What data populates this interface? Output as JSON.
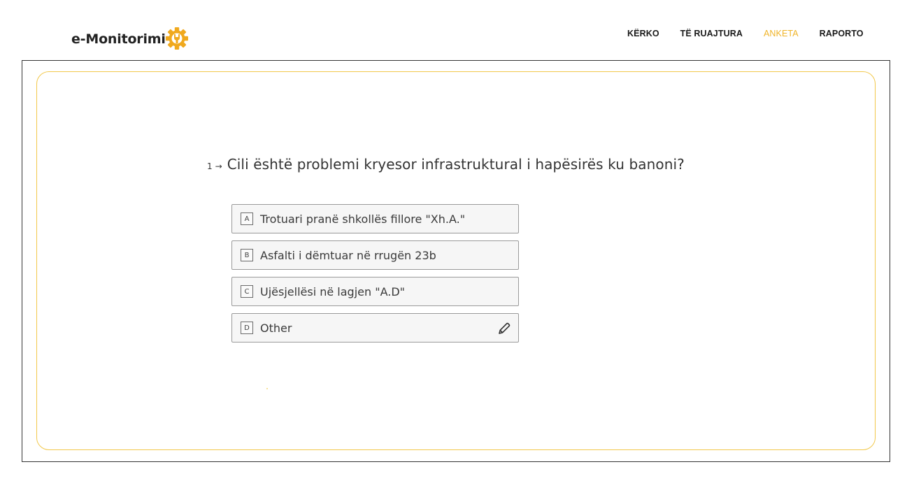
{
  "header": {
    "logo_text": "e-Monitorimi",
    "logo_icon": "gear-wrench-icon",
    "brand_color": "#f0b429"
  },
  "nav": {
    "items": [
      {
        "label": "KËRKO",
        "active": false
      },
      {
        "label": "TË RUAJTURA",
        "active": false
      },
      {
        "label": "ANKETA",
        "active": true
      },
      {
        "label": "RAPORTO",
        "active": false
      }
    ]
  },
  "question": {
    "number": "1",
    "arrow": "→",
    "text": "Cili është problemi kryesor infrastruktural i hapësirës ku banoni?"
  },
  "options": [
    {
      "key": "A",
      "label": "Trotuari pranë shkollës fillore \"Xh.A.\""
    },
    {
      "key": "B",
      "label": "Asfalti i dëmtuar në rrugën 23b"
    },
    {
      "key": "C",
      "label": "Ujësjellësi në lagjen \"A.D\""
    },
    {
      "key": "D",
      "label": "Other",
      "icon": "pencil-icon"
    }
  ]
}
